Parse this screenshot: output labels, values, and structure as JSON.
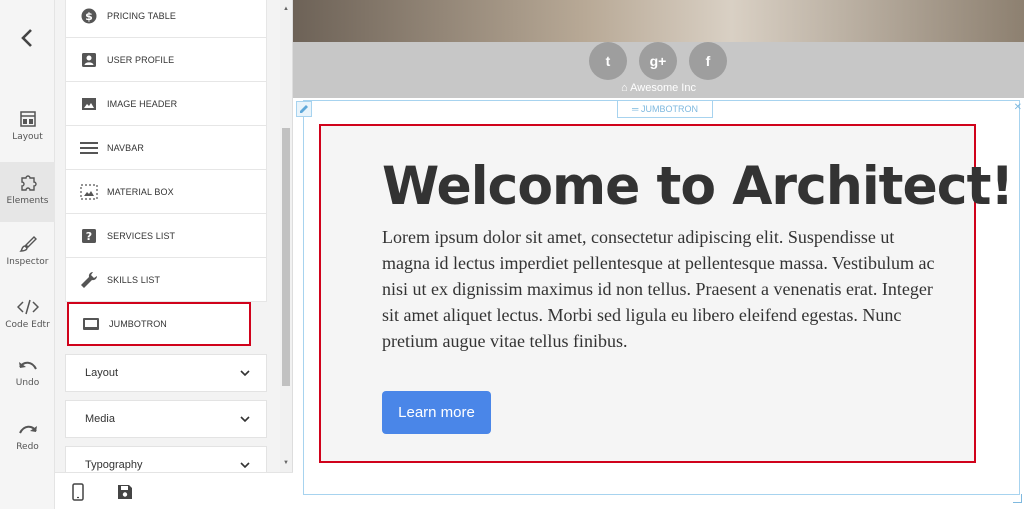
{
  "rail": {
    "items": [
      {
        "label": "Layout",
        "icon": "layout-icon"
      },
      {
        "label": "Elements",
        "icon": "puzzle-icon"
      },
      {
        "label": "Inspector",
        "icon": "brush-icon"
      },
      {
        "label": "Code Edtr",
        "icon": "code-icon"
      },
      {
        "label": "Undo",
        "icon": "undo-icon"
      },
      {
        "label": "Redo",
        "icon": "redo-icon"
      }
    ]
  },
  "elements": [
    {
      "label": "PRICING TABLE",
      "icon": "dollar-circle-icon"
    },
    {
      "label": "USER PROFILE",
      "icon": "person-box-icon"
    },
    {
      "label": "IMAGE HEADER",
      "icon": "image-icon"
    },
    {
      "label": "NAVBAR",
      "icon": "menu-icon"
    },
    {
      "label": "MATERIAL BOX",
      "icon": "image-dashed-icon"
    },
    {
      "label": "SERVICES LIST",
      "icon": "help-box-icon"
    },
    {
      "label": "SKILLS LIST",
      "icon": "wrench-icon"
    },
    {
      "label": "JUMBOTRON",
      "icon": "jumbotron-icon"
    }
  ],
  "accordions": [
    {
      "label": "Layout"
    },
    {
      "label": "Media"
    },
    {
      "label": "Typography"
    }
  ],
  "canvas": {
    "social": [
      "t",
      "g+",
      "f"
    ],
    "brand": "Awesome Inc",
    "jumbotron_tag": "JUMBOTRON",
    "jumbotron": {
      "title": "Welcome to Architect!",
      "body": "Lorem ipsum dolor sit amet, consectetur adipiscing elit. Suspendisse ut magna id lectus imperdiet pellentesque at pellentesque massa. Vestibulum ac nisi ut ex dignissim maximus id non tellus. Praesent a venenatis erat. Integer sit amet aliquet lectus. Morbi sed ligula eu libero eleifend egestas. Nunc pretium augue vitae tellus finibus.",
      "button": "Learn more"
    }
  },
  "colors": {
    "accent": "#4a86e8",
    "highlight": "#d0021b",
    "selection": "#a7d3ef"
  }
}
